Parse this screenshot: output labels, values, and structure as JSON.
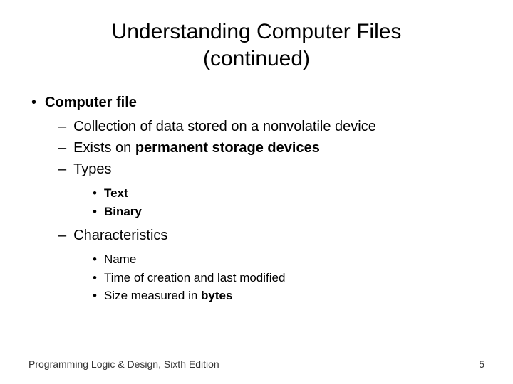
{
  "title_line1": "Understanding Computer Files",
  "title_line2": "(continued)",
  "b1": "Computer file",
  "b2a": "Collection of data stored on a nonvolatile device",
  "b2b_pre": "Exists on ",
  "b2b_bold": "permanent storage devices",
  "b2c": "Types",
  "b3a": "Text",
  "b3b": "Binary",
  "b2d": "Characteristics",
  "b3c": "Name",
  "b3d": "Time of creation and last modified",
  "b3e_pre": "Size measured in ",
  "b3e_bold": "bytes",
  "footer_left": "Programming Logic & Design, Sixth Edition",
  "footer_right": "5"
}
